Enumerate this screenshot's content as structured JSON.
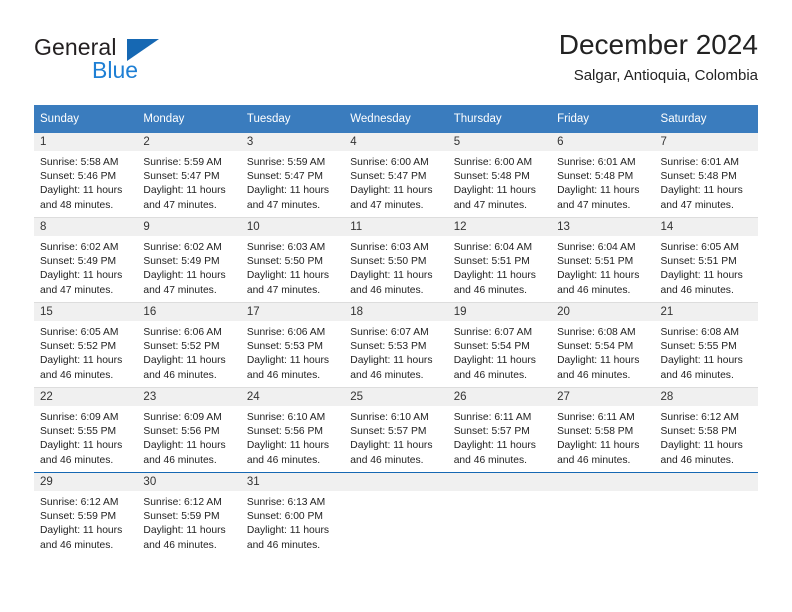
{
  "brand": {
    "name_top": "General",
    "name_bottom": "Blue",
    "accent_color": "#1668b3",
    "text_color": "#231f20"
  },
  "header": {
    "title": "December 2024",
    "subtitle": "Salgar, Antioquia, Colombia"
  },
  "calendar": {
    "header_bg": "#3a7cbe",
    "header_text_color": "#ffffff",
    "daynum_bg": "#f0f0f0",
    "weekdays": [
      "Sunday",
      "Monday",
      "Tuesday",
      "Wednesday",
      "Thursday",
      "Friday",
      "Saturday"
    ],
    "weeks": [
      [
        {
          "day": "1",
          "sunrise": "Sunrise: 5:58 AM",
          "sunset": "Sunset: 5:46 PM",
          "daylight_1": "Daylight: 11 hours",
          "daylight_2": "and 48 minutes."
        },
        {
          "day": "2",
          "sunrise": "Sunrise: 5:59 AM",
          "sunset": "Sunset: 5:47 PM",
          "daylight_1": "Daylight: 11 hours",
          "daylight_2": "and 47 minutes."
        },
        {
          "day": "3",
          "sunrise": "Sunrise: 5:59 AM",
          "sunset": "Sunset: 5:47 PM",
          "daylight_1": "Daylight: 11 hours",
          "daylight_2": "and 47 minutes."
        },
        {
          "day": "4",
          "sunrise": "Sunrise: 6:00 AM",
          "sunset": "Sunset: 5:47 PM",
          "daylight_1": "Daylight: 11 hours",
          "daylight_2": "and 47 minutes."
        },
        {
          "day": "5",
          "sunrise": "Sunrise: 6:00 AM",
          "sunset": "Sunset: 5:48 PM",
          "daylight_1": "Daylight: 11 hours",
          "daylight_2": "and 47 minutes."
        },
        {
          "day": "6",
          "sunrise": "Sunrise: 6:01 AM",
          "sunset": "Sunset: 5:48 PM",
          "daylight_1": "Daylight: 11 hours",
          "daylight_2": "and 47 minutes."
        },
        {
          "day": "7",
          "sunrise": "Sunrise: 6:01 AM",
          "sunset": "Sunset: 5:48 PM",
          "daylight_1": "Daylight: 11 hours",
          "daylight_2": "and 47 minutes."
        }
      ],
      [
        {
          "day": "8",
          "sunrise": "Sunrise: 6:02 AM",
          "sunset": "Sunset: 5:49 PM",
          "daylight_1": "Daylight: 11 hours",
          "daylight_2": "and 47 minutes."
        },
        {
          "day": "9",
          "sunrise": "Sunrise: 6:02 AM",
          "sunset": "Sunset: 5:49 PM",
          "daylight_1": "Daylight: 11 hours",
          "daylight_2": "and 47 minutes."
        },
        {
          "day": "10",
          "sunrise": "Sunrise: 6:03 AM",
          "sunset": "Sunset: 5:50 PM",
          "daylight_1": "Daylight: 11 hours",
          "daylight_2": "and 47 minutes."
        },
        {
          "day": "11",
          "sunrise": "Sunrise: 6:03 AM",
          "sunset": "Sunset: 5:50 PM",
          "daylight_1": "Daylight: 11 hours",
          "daylight_2": "and 46 minutes."
        },
        {
          "day": "12",
          "sunrise": "Sunrise: 6:04 AM",
          "sunset": "Sunset: 5:51 PM",
          "daylight_1": "Daylight: 11 hours",
          "daylight_2": "and 46 minutes."
        },
        {
          "day": "13",
          "sunrise": "Sunrise: 6:04 AM",
          "sunset": "Sunset: 5:51 PM",
          "daylight_1": "Daylight: 11 hours",
          "daylight_2": "and 46 minutes."
        },
        {
          "day": "14",
          "sunrise": "Sunrise: 6:05 AM",
          "sunset": "Sunset: 5:51 PM",
          "daylight_1": "Daylight: 11 hours",
          "daylight_2": "and 46 minutes."
        }
      ],
      [
        {
          "day": "15",
          "sunrise": "Sunrise: 6:05 AM",
          "sunset": "Sunset: 5:52 PM",
          "daylight_1": "Daylight: 11 hours",
          "daylight_2": "and 46 minutes."
        },
        {
          "day": "16",
          "sunrise": "Sunrise: 6:06 AM",
          "sunset": "Sunset: 5:52 PM",
          "daylight_1": "Daylight: 11 hours",
          "daylight_2": "and 46 minutes."
        },
        {
          "day": "17",
          "sunrise": "Sunrise: 6:06 AM",
          "sunset": "Sunset: 5:53 PM",
          "daylight_1": "Daylight: 11 hours",
          "daylight_2": "and 46 minutes."
        },
        {
          "day": "18",
          "sunrise": "Sunrise: 6:07 AM",
          "sunset": "Sunset: 5:53 PM",
          "daylight_1": "Daylight: 11 hours",
          "daylight_2": "and 46 minutes."
        },
        {
          "day": "19",
          "sunrise": "Sunrise: 6:07 AM",
          "sunset": "Sunset: 5:54 PM",
          "daylight_1": "Daylight: 11 hours",
          "daylight_2": "and 46 minutes."
        },
        {
          "day": "20",
          "sunrise": "Sunrise: 6:08 AM",
          "sunset": "Sunset: 5:54 PM",
          "daylight_1": "Daylight: 11 hours",
          "daylight_2": "and 46 minutes."
        },
        {
          "day": "21",
          "sunrise": "Sunrise: 6:08 AM",
          "sunset": "Sunset: 5:55 PM",
          "daylight_1": "Daylight: 11 hours",
          "daylight_2": "and 46 minutes."
        }
      ],
      [
        {
          "day": "22",
          "sunrise": "Sunrise: 6:09 AM",
          "sunset": "Sunset: 5:55 PM",
          "daylight_1": "Daylight: 11 hours",
          "daylight_2": "and 46 minutes."
        },
        {
          "day": "23",
          "sunrise": "Sunrise: 6:09 AM",
          "sunset": "Sunset: 5:56 PM",
          "daylight_1": "Daylight: 11 hours",
          "daylight_2": "and 46 minutes."
        },
        {
          "day": "24",
          "sunrise": "Sunrise: 6:10 AM",
          "sunset": "Sunset: 5:56 PM",
          "daylight_1": "Daylight: 11 hours",
          "daylight_2": "and 46 minutes."
        },
        {
          "day": "25",
          "sunrise": "Sunrise: 6:10 AM",
          "sunset": "Sunset: 5:57 PM",
          "daylight_1": "Daylight: 11 hours",
          "daylight_2": "and 46 minutes."
        },
        {
          "day": "26",
          "sunrise": "Sunrise: 6:11 AM",
          "sunset": "Sunset: 5:57 PM",
          "daylight_1": "Daylight: 11 hours",
          "daylight_2": "and 46 minutes."
        },
        {
          "day": "27",
          "sunrise": "Sunrise: 6:11 AM",
          "sunset": "Sunset: 5:58 PM",
          "daylight_1": "Daylight: 11 hours",
          "daylight_2": "and 46 minutes."
        },
        {
          "day": "28",
          "sunrise": "Sunrise: 6:12 AM",
          "sunset": "Sunset: 5:58 PM",
          "daylight_1": "Daylight: 11 hours",
          "daylight_2": "and 46 minutes."
        }
      ],
      [
        {
          "day": "29",
          "sunrise": "Sunrise: 6:12 AM",
          "sunset": "Sunset: 5:59 PM",
          "daylight_1": "Daylight: 11 hours",
          "daylight_2": "and 46 minutes."
        },
        {
          "day": "30",
          "sunrise": "Sunrise: 6:12 AM",
          "sunset": "Sunset: 5:59 PM",
          "daylight_1": "Daylight: 11 hours",
          "daylight_2": "and 46 minutes."
        },
        {
          "day": "31",
          "sunrise": "Sunrise: 6:13 AM",
          "sunset": "Sunset: 6:00 PM",
          "daylight_1": "Daylight: 11 hours",
          "daylight_2": "and 46 minutes."
        },
        {
          "day": "",
          "sunrise": "",
          "sunset": "",
          "daylight_1": "",
          "daylight_2": ""
        },
        {
          "day": "",
          "sunrise": "",
          "sunset": "",
          "daylight_1": "",
          "daylight_2": ""
        },
        {
          "day": "",
          "sunrise": "",
          "sunset": "",
          "daylight_1": "",
          "daylight_2": ""
        },
        {
          "day": "",
          "sunrise": "",
          "sunset": "",
          "daylight_1": "",
          "daylight_2": ""
        }
      ]
    ]
  }
}
